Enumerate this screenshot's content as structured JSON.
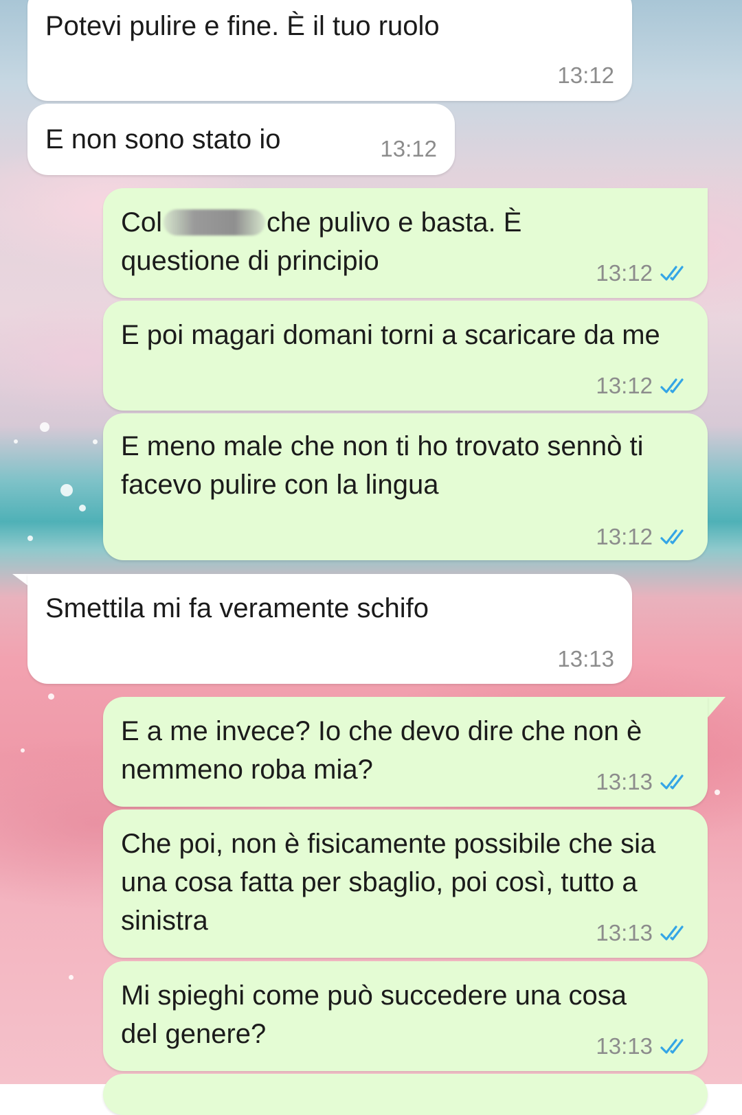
{
  "messages": [
    {
      "direction": "incoming",
      "text": "Potevi pulire e fine. È il tuo ruolo",
      "time": "13:12"
    },
    {
      "direction": "incoming",
      "text": "E non sono stato io",
      "time": "13:12"
    },
    {
      "direction": "outgoing",
      "text_before": "Col",
      "text_after": "che pulivo e basta. È",
      "text_line2": "questione di principio",
      "time": "13:12",
      "status": "read"
    },
    {
      "direction": "outgoing",
      "text": "E poi magari domani torni a scaricare da me",
      "time": "13:12",
      "status": "read"
    },
    {
      "direction": "outgoing",
      "text": "E meno male che non ti ho trovato sennò ti facevo pulire con la lingua",
      "time": "13:12",
      "status": "read"
    },
    {
      "direction": "incoming",
      "text": "Smettila mi fa veramente schifo",
      "time": "13:13"
    },
    {
      "direction": "outgoing",
      "text": "E a me invece? Io che devo dire che non è nemmeno roba mia?",
      "time": "13:13",
      "status": "read"
    },
    {
      "direction": "outgoing",
      "text": "Che poi, non è fisicamente possibile che sia una cosa fatta per sbaglio, poi così, tutto a sinistra",
      "time": "13:13",
      "status": "read"
    },
    {
      "direction": "outgoing",
      "text": "Mi spieghi come può succedere una cosa del genere?",
      "time": "13:13",
      "status": "read"
    }
  ],
  "colors": {
    "incoming_bubble": "#ffffff",
    "outgoing_bubble": "#e4fcd4",
    "read_ticks": "#34a5e6",
    "timestamp": "#8c8c8c"
  },
  "icons": {
    "read_receipt": "double-check-icon"
  }
}
